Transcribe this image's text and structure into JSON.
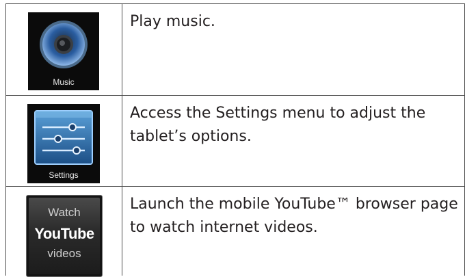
{
  "rows": [
    {
      "icon_name": "music-speaker-icon",
      "icon_label": "Music",
      "description": "Play music."
    },
    {
      "icon_name": "settings-sliders-icon",
      "icon_label": "Settings",
      "description": "Access the Settings menu to adjust the tablet’s options."
    },
    {
      "icon_name": "youtube-icon",
      "icon_label_top": "Watch",
      "icon_label_brand": "YouTube",
      "icon_label_bottom": "videos",
      "description": "Launch the mobile YouTube™ browser page to watch internet videos."
    }
  ]
}
